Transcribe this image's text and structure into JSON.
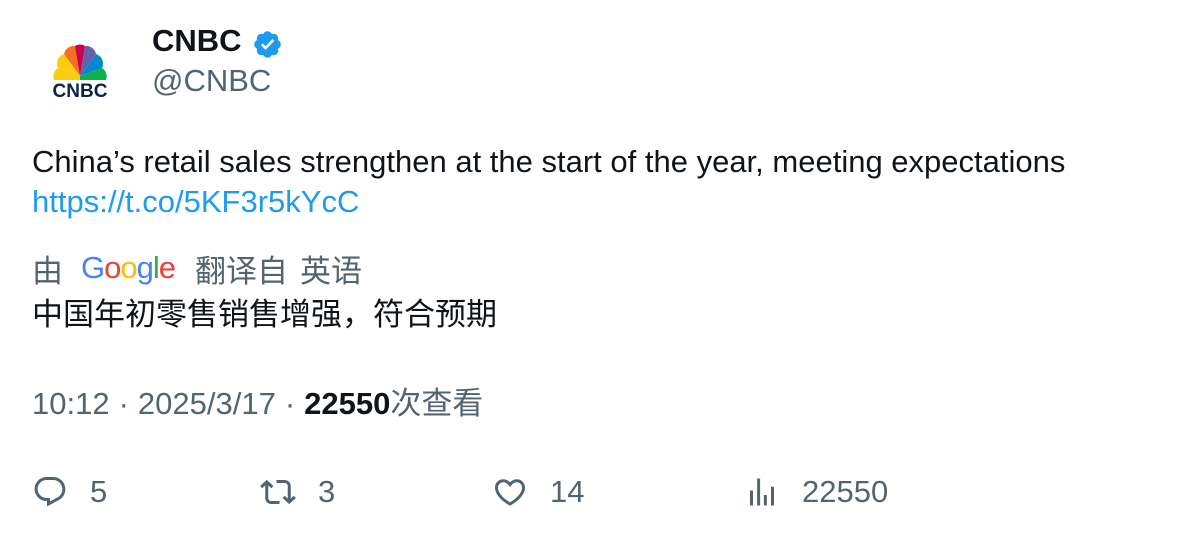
{
  "author": {
    "display_name": "CNBC",
    "handle": "@CNBC",
    "verified": true,
    "logo_text": "CNBC",
    "verified_color": "#1d9bf0"
  },
  "tweet": {
    "text": "China’s retail sales strengthen at the start of the year, meeting expectations",
    "link": "https://t.co/5KF3r5kYcC"
  },
  "translation": {
    "by_label": "由",
    "provider_letters": [
      "G",
      "o",
      "o",
      "g",
      "l",
      "e"
    ],
    "from_label": "翻译自",
    "language": "英语",
    "translated_text": "中国年初零售销售增强，符合预期"
  },
  "meta": {
    "time": "10:12",
    "date": "2025/3/17",
    "views_count": "22550",
    "views_suffix": "次查看",
    "separator": "·"
  },
  "actions": {
    "reply_count": "5",
    "retweet_count": "3",
    "like_count": "14",
    "views_count": "22550"
  },
  "colors": {
    "text_primary": "#0f1419",
    "text_secondary": "#536471",
    "link": "#1d9bf0"
  },
  "icons": {
    "reply": "reply-icon",
    "retweet": "retweet-icon",
    "like": "heart-icon",
    "views": "bar-chart-icon",
    "verified": "verified-badge-icon"
  }
}
